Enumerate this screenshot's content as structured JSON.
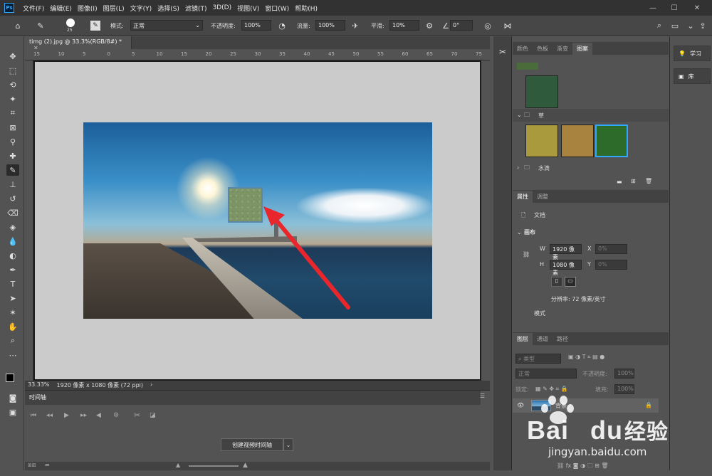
{
  "menubar": {
    "logo": "Ps",
    "items": [
      "文件(F)",
      "编辑(E)",
      "图像(I)",
      "图层(L)",
      "文字(Y)",
      "选择(S)",
      "滤镜(T)",
      "3D(D)",
      "视图(V)",
      "窗口(W)",
      "帮助(H)"
    ],
    "minimize": "—",
    "maximize": "☐",
    "close": "✕"
  },
  "options": {
    "brush_size": "25",
    "mode_label": "模式:",
    "mode_value": "正常",
    "opacity_label": "不透明度:",
    "opacity_value": "100%",
    "flow_label": "流量:",
    "flow_value": "100%",
    "smooth_label": "平滑:",
    "smooth_value": "10%",
    "angle_value": "0°"
  },
  "document": {
    "tab_title": "timg (2).jpg @ 33.3%(RGB/8#) *",
    "tab_close": "✕",
    "zoom": "33.33%",
    "info": "1920 像素 x 1080 像素 (72 ppi)",
    "ruler_top": [
      "15",
      "10",
      "5",
      "0",
      "5",
      "10",
      "15",
      "20",
      "25",
      "30",
      "35",
      "40",
      "45",
      "50",
      "55",
      "60",
      "65",
      "70",
      "75"
    ]
  },
  "timeline": {
    "tab": "时间轴",
    "create_button": "创建视频时间轴"
  },
  "panels": {
    "pattern_tabs": [
      "颜色",
      "色板",
      "渐变",
      "图案"
    ],
    "pattern_active": 3,
    "groups": [
      {
        "name": "草",
        "expanded": true
      },
      {
        "name": "水滴",
        "expanded": false
      }
    ],
    "props_tabs": [
      "属性",
      "调整"
    ],
    "props_doc_label": "文档",
    "canvas_section": "画布",
    "w_label": "W",
    "w_value": "1920 像素",
    "h_label": "H",
    "h_value": "1080 像素",
    "x_label": "X",
    "x_value": "0%",
    "y_label": "Y",
    "y_value": "0%",
    "resolution": "分辨率: 72 像素/英寸",
    "mode_section": "模式",
    "layers_tabs": [
      "图层",
      "通道",
      "路径"
    ],
    "layers_search": "类型",
    "blend_mode": "正常",
    "layer_opacity_label": "不透明度:",
    "layer_opacity": "100%",
    "lock_label": "锁定:",
    "fill_label": "填充:",
    "fill_value": "100%",
    "layer_name": "背景"
  },
  "learn": {
    "learn_label": "学习",
    "library_label": "库"
  },
  "watermark": {
    "brand": "Bai",
    "brand2": "du",
    "cn": "经验",
    "url": "jingyan.baidu.com"
  },
  "colors": {
    "accent": "#31a8ff",
    "arrow": "#e8262b"
  }
}
